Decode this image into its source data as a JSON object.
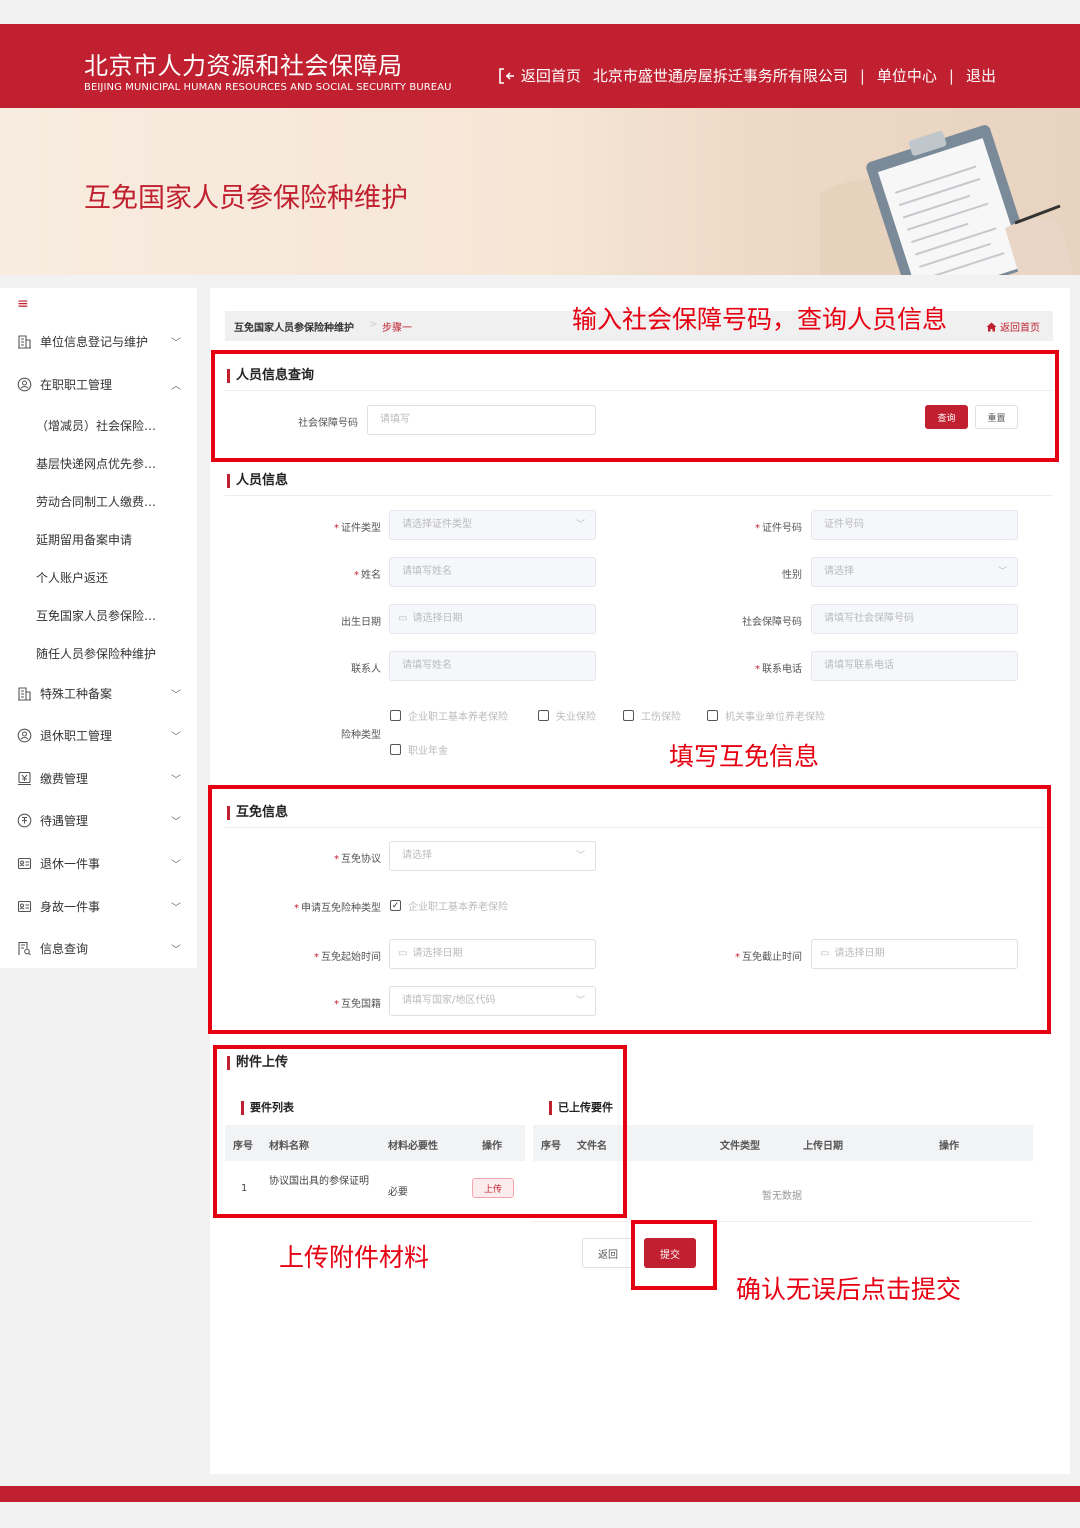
{
  "header": {
    "title": "北京市人力资源和社会保障局",
    "subtitle": "BEIJING MUNICIPAL HUMAN RESOURCES AND SOCIAL SECURITY BUREAU",
    "nav": {
      "home": "返回首页",
      "company": "北京市盛世通房屋拆迁事务所有限公司",
      "sep": "|",
      "unit_center": "单位中心",
      "logout": "退出"
    }
  },
  "banner": {
    "title": "互免国家人员参保险种维护"
  },
  "sidebar": {
    "menu_icon": "≡",
    "items": [
      {
        "label": "单位信息登记与维护",
        "icon": "building-icon"
      },
      {
        "label": "在职职工管理",
        "icon": "user-circle-icon"
      },
      {
        "label": "特殊工种备案",
        "icon": "building-icon"
      },
      {
        "label": "退休职工管理",
        "icon": "user-circle-icon"
      },
      {
        "label": "缴费管理",
        "icon": "payment-icon"
      },
      {
        "label": "待遇管理",
        "icon": "benefit-icon"
      },
      {
        "label": "退休一件事",
        "icon": "id-card-icon"
      },
      {
        "label": "身故一件事",
        "icon": "id-card-icon"
      },
      {
        "label": "信息查询",
        "icon": "search-doc-icon"
      }
    ],
    "subitems": [
      "（增减员）社会保险…",
      "基层快递网点优先参…",
      "劳动合同制工人缴费…",
      "延期留用备案申请",
      "个人账户返还",
      "互免国家人员参保险…",
      "随任人员参保险种维护"
    ]
  },
  "breadcrumb": {
    "item1": "互免国家人员参保险种维护",
    "sep": ">",
    "item2": "步骤一",
    "home": "返回首页"
  },
  "query": {
    "title": "人员信息查询",
    "ssn_label": "社会保障号码",
    "ssn_placeholder": "请填写",
    "query_btn": "查询",
    "reset_btn": "重置"
  },
  "person": {
    "title": "人员信息",
    "id_type_label": "证件类型",
    "id_type_placeholder": "请选择证件类型",
    "id_no_label": "证件号码",
    "id_no_placeholder": "证件号码",
    "name_label": "姓名",
    "name_placeholder": "请填写姓名",
    "gender_label": "性别",
    "gender_placeholder": "请选择",
    "birth_label": "出生日期",
    "birth_placeholder": "请选择日期",
    "ssn_label": "社会保障号码",
    "ssn_placeholder": "请填写社会保障号码",
    "contact_label": "联系人",
    "contact_placeholder": "请填写姓名",
    "phone_label": "联系电话",
    "phone_placeholder": "请填写联系电话",
    "insurance_label": "险种类型",
    "insurance_options": [
      "企业职工基本养老保险",
      "失业保险",
      "工伤保险",
      "机关事业单位养老保险",
      "职业年金"
    ]
  },
  "exemption": {
    "title": "互免信息",
    "agreement_label": "互免协议",
    "agreement_placeholder": "请选择",
    "type_label": "申请互免险种类型",
    "type_option": "企业职工基本养老保险",
    "start_label": "互免起始时间",
    "start_placeholder": "请选择日期",
    "end_label": "互免截止时间",
    "end_placeholder": "请选择日期",
    "country_label": "互免国籍",
    "country_placeholder": "请填写国家/地区代码"
  },
  "attachments": {
    "title": "附件上传",
    "required_title": "要件列表",
    "uploaded_title": "已上传要件",
    "req_cols": [
      "序号",
      "材料名称",
      "材料必要性",
      "操作"
    ],
    "up_cols": [
      "序号",
      "文件名",
      "文件类型",
      "上传日期",
      "操作"
    ],
    "rows": [
      {
        "no": "1",
        "name": "协议国出具的参保证明",
        "necessity": "必要",
        "action": "上传"
      }
    ],
    "empty": "暂无数据"
  },
  "actions": {
    "back": "返回",
    "submit": "提交"
  },
  "annotations": {
    "a1": "输入社会保障号码，查询人员信息",
    "a2": "填写互免信息",
    "a3": "上传附件材料",
    "a4": "确认无误后点击提交"
  },
  "colors": {
    "brand": "#c0202f",
    "annotation": "#e60012"
  }
}
